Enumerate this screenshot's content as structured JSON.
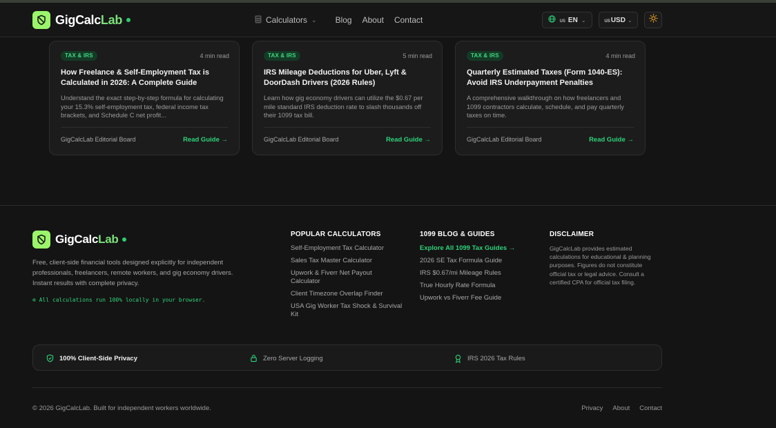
{
  "brand": {
    "name_main": "GigCalc",
    "name_accent": "Lab",
    "accent_color": "#2fd27a",
    "logo_bg": "#9af56a"
  },
  "nav": {
    "calculators_label": "Calculators",
    "blog_label": "Blog",
    "about_label": "About",
    "contact_label": "Contact",
    "language_flag": "us",
    "language_code": "EN",
    "currency_flag": "us",
    "currency_code": "USD",
    "theme_icon": "sun-icon"
  },
  "cards": [
    {
      "tag": "TAX & IRS",
      "read_time": "4 min read",
      "title": "How Freelance & Self-Employment Tax is Calculated in 2026: A Complete Guide",
      "description": "Understand the exact step-by-step formula for calculating your 15.3% self-employment tax, federal income tax brackets, and Schedule C net profit...",
      "author": "GigCalcLab Editorial Board",
      "cta": "Read Guide →"
    },
    {
      "tag": "TAX & IRS",
      "read_time": "5 min read",
      "title": "IRS Mileage Deductions for Uber, Lyft & DoorDash Drivers (2026 Rules)",
      "description": "Learn how gig economy drivers can utilize the $0.67 per mile standard IRS deduction rate to slash thousands off their 1099 tax bill.",
      "author": "GigCalcLab Editorial Board",
      "cta": "Read Guide →"
    },
    {
      "tag": "TAX & IRS",
      "read_time": "4 min read",
      "title": "Quarterly Estimated Taxes (Form 1040-ES): Avoid IRS Underpayment Penalties",
      "description": "A comprehensive walkthrough on how freelancers and 1099 contractors calculate, schedule, and pay quarterly taxes on time.",
      "author": "GigCalcLab Editorial Board",
      "cta": "Read Guide →"
    }
  ],
  "footer": {
    "description": "Free, client-side financial tools designed explicitly for independent professionals, freelancers, remote workers, and gig economy drivers. Instant results with complete privacy.",
    "local_note": "⊕ All calculations run 100% locally in your browser.",
    "popular": {
      "heading": "POPULAR CALCULATORS",
      "links": [
        "Self-Employment Tax Calculator",
        "Sales Tax Master Calculator",
        "Upwork & Fiverr Net Payout Calculator",
        "Client Timezone Overlap Finder",
        "USA Gig Worker Tax Shock & Survival Kit"
      ]
    },
    "blog": {
      "heading": "1099 BLOG & GUIDES",
      "links": [
        "Explore All 1099 Tax Guides →",
        "2026 SE Tax Formula Guide",
        "IRS $0.67/mi Mileage Rules",
        "True Hourly Rate Formula",
        "Upwork vs Fiverr Fee Guide"
      ]
    },
    "disclaimer": {
      "heading": "DISCLAIMER",
      "text": "GigCalcLab provides estimated calculations for educational & planning purposes. Figures do not constitute official tax or legal advice. Consult a certified CPA for official tax filing."
    },
    "trust": {
      "privacy": "100% Client-Side Privacy",
      "logging": "Zero Server Logging",
      "rules": "IRS 2026 Tax Rules"
    },
    "copyright": "© 2026 GigCalcLab. Built for independent workers worldwide.",
    "bottom_links": {
      "privacy": "Privacy",
      "about": "About",
      "contact": "Contact"
    }
  }
}
